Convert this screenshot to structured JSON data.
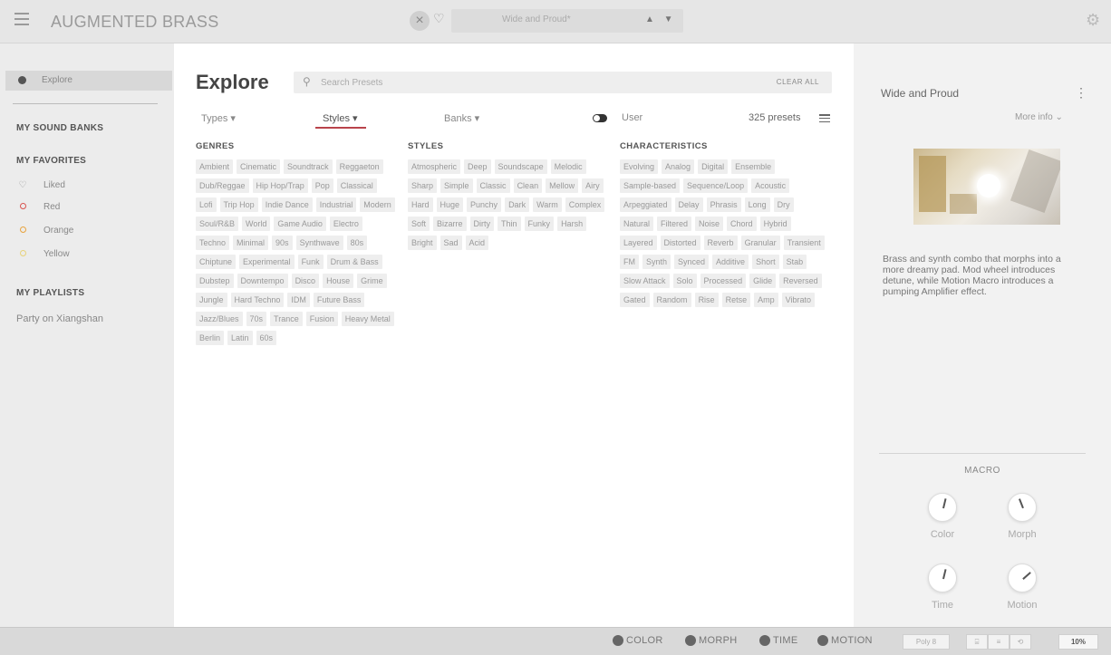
{
  "app": {
    "title": "AUGMENTED BRASS"
  },
  "topbar": {
    "preset_name": "Wide and Proud*",
    "clear_glyph": "×",
    "heart_glyph": "♡",
    "arrows": "▲ ▼",
    "settings_glyph": "⚙"
  },
  "sidebar": {
    "explore_label": "Explore",
    "sound_banks_heading": "MY SOUND BANKS",
    "favorites_heading": "MY FAVORITES",
    "favorites": [
      {
        "label": "Liked",
        "icon": "heart-icon",
        "color": "#999999"
      },
      {
        "label": "Red",
        "icon": "circle-icon",
        "color": "#d9534f"
      },
      {
        "label": "Orange",
        "icon": "circle-icon",
        "color": "#e8a33d"
      },
      {
        "label": "Yellow",
        "icon": "circle-icon",
        "color": "#e8d27a"
      }
    ],
    "playlists_heading": "MY PLAYLISTS",
    "playlists": [
      "Party on Xiangshan"
    ]
  },
  "main": {
    "title": "Explore",
    "search": {
      "placeholder": "Search Presets",
      "value": ""
    },
    "clear_all": "CLEAR ALL",
    "tabs": {
      "types": "Types ▾",
      "styles": "Styles ▾",
      "banks": "Banks ▾"
    },
    "active_tab": "Styles",
    "accent_color": "#b9434b",
    "user_label": "User",
    "preset_count": "325 presets",
    "genres": {
      "heading": "GENRES",
      "tags": [
        "Ambient",
        "Cinematic",
        "Soundtrack",
        "Reggaeton",
        "Dub/Reggae",
        "Hip Hop/Trap",
        "Pop",
        "Classical",
        "Lofi",
        "Trip Hop",
        "Indie Dance",
        "Industrial",
        "Modern",
        "Soul/R&B",
        "World",
        "Game Audio",
        "Electro",
        "Techno",
        "Minimal",
        "90s",
        "Synthwave",
        "80s",
        "Chiptune",
        "Experimental",
        "Funk",
        "Drum & Bass",
        "Dubstep",
        "Downtempo",
        "Disco",
        "House",
        "Grime",
        "Jungle",
        "Hard Techno",
        "IDM",
        "Future Bass",
        "Jazz/Blues",
        "70s",
        "Trance",
        "Fusion",
        "Heavy Metal",
        "Berlin",
        "Latin",
        "60s"
      ]
    },
    "styles": {
      "heading": "STYLES",
      "tags": [
        "Atmospheric",
        "Deep",
        "Soundscape",
        "Melodic",
        "Sharp",
        "Simple",
        "Classic",
        "Clean",
        "Mellow",
        "Airy",
        "Hard",
        "Huge",
        "Punchy",
        "Dark",
        "Warm",
        "Complex",
        "Soft",
        "Bizarre",
        "Dirty",
        "Thin",
        "Funky",
        "Harsh",
        "Bright",
        "Sad",
        "Acid"
      ]
    },
    "characteristics": {
      "heading": "CHARACTERISTICS",
      "tags": [
        "Evolving",
        "Analog",
        "Digital",
        "Ensemble",
        "Sample-based",
        "Sequence/Loop",
        "Acoustic",
        "Arpeggiated",
        "Delay",
        "Phrasis",
        "Long",
        "Dry",
        "Natural",
        "Filtered",
        "Noise",
        "Chord",
        "Hybrid",
        "Layered",
        "Distorted",
        "Reverb",
        "Granular",
        "Transient",
        "FM",
        "Synth",
        "Synced",
        "Additive",
        "Short",
        "Stab",
        "Slow Attack",
        "Solo",
        "Processed",
        "Glide",
        "Reversed",
        "Gated",
        "Random",
        "Rise",
        "Retse",
        "Amp",
        "Vibrato"
      ]
    }
  },
  "right_panel": {
    "preset_name": "Wide and Proud",
    "kebab_glyph": "⋮",
    "more_info": "More info ⌄",
    "description": "Brass and synth combo that morphs into a more dreamy pad. Mod wheel introduces detune, while Motion Macro introduces a pumping Amplifier effect.",
    "macro_title": "MACRO",
    "macros": [
      {
        "label": "Color",
        "value": 0.55
      },
      {
        "label": "Morph",
        "value": 0.42
      },
      {
        "label": "Time",
        "value": 0.55
      },
      {
        "label": "Motion",
        "value": 0.68
      }
    ]
  },
  "bottom_bar": {
    "macros": [
      "COLOR",
      "MORPH",
      "TIME",
      "MOTION"
    ],
    "poly_label": "Poly 8",
    "zoom": "10%"
  }
}
